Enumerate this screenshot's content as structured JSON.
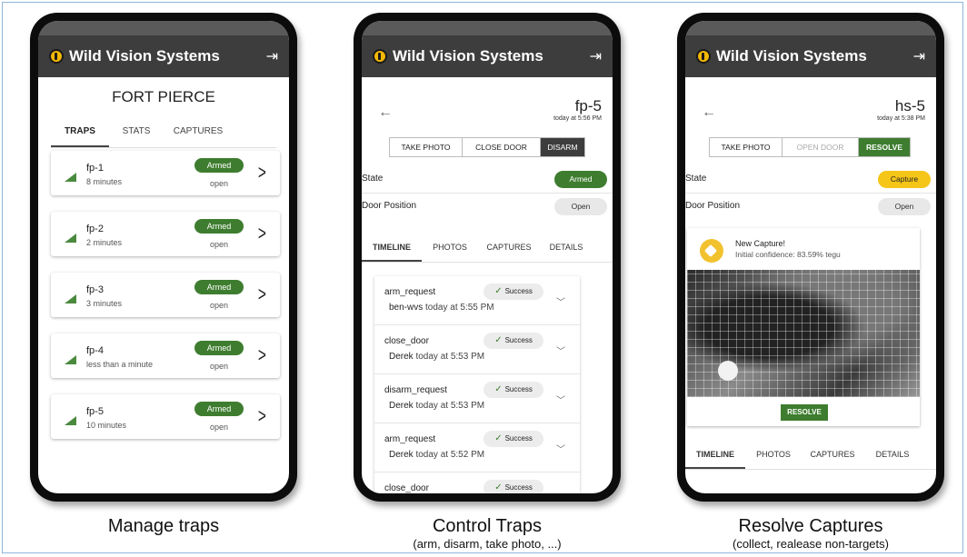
{
  "app": {
    "title": "Wild Vision Systems"
  },
  "manage": {
    "location": "FORT PIERCE",
    "tabs": [
      "TRAPS",
      "STATS",
      "CAPTURES"
    ],
    "traps": [
      {
        "name": "fp-1",
        "ago": "8 minutes",
        "state": "Armed",
        "door": "open"
      },
      {
        "name": "fp-2",
        "ago": "2 minutes",
        "state": "Armed",
        "door": "open"
      },
      {
        "name": "fp-3",
        "ago": "3 minutes",
        "state": "Armed",
        "door": "open"
      },
      {
        "name": "fp-4",
        "ago": "less than a minute",
        "state": "Armed",
        "door": "open"
      },
      {
        "name": "fp-5",
        "ago": "10 minutes",
        "state": "Armed",
        "door": "open"
      }
    ],
    "caption": "Manage traps"
  },
  "control": {
    "trap_id": "fp-5",
    "updated": "today at 5:56 PM",
    "buttons": [
      "TAKE PHOTO",
      "CLOSE DOOR",
      "DISARM"
    ],
    "state_label": "State",
    "state_value": "Armed",
    "door_label": "Door Position",
    "door_value": "Open",
    "tabs": [
      "TIMELINE",
      "PHOTOS",
      "CAPTURES",
      "DETAILS"
    ],
    "timeline": [
      {
        "action": "arm_request",
        "user": "ben-wvs",
        "time": "today at 5:55 PM",
        "status": "Success"
      },
      {
        "action": "close_door",
        "user": "Derek",
        "time": "today at 5:53 PM",
        "status": "Success"
      },
      {
        "action": "disarm_request",
        "user": "Derek",
        "time": "today at 5:53 PM",
        "status": "Success"
      },
      {
        "action": "arm_request",
        "user": "Derek",
        "time": "today at 5:52 PM",
        "status": "Success"
      },
      {
        "action": "close_door",
        "user": "",
        "time": "",
        "status": "Success"
      }
    ],
    "caption": "Control Traps",
    "subcaption": "(arm, disarm, take photo, ...)"
  },
  "resolve": {
    "trap_id": "hs-5",
    "updated": "today at 5:38 PM",
    "buttons": [
      "TAKE PHOTO",
      "OPEN DOOR",
      "RESOLVE"
    ],
    "state_label": "State",
    "state_value": "Capture",
    "door_label": "Door Position",
    "door_value": "Open",
    "capture_title": "New Capture!",
    "capture_confidence": "Initial confidence: 83.59% tegu",
    "resolve_button": "RESOLVE",
    "tabs": [
      "TIMELINE",
      "PHOTOS",
      "CAPTURES",
      "DETAILS"
    ],
    "caption": "Resolve Captures",
    "subcaption": "(collect, realease non-targets)"
  },
  "colors": {
    "armed": "#3e7d2f",
    "capture": "#f5c518",
    "appbar": "#3d3d3d",
    "logo": "#f2b705"
  }
}
